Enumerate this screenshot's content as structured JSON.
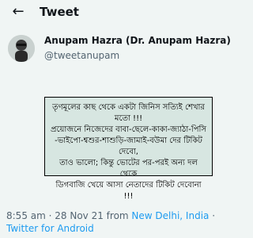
{
  "topbar": {
    "title": "Tweet",
    "back_icon": "back-arrow-icon"
  },
  "author": {
    "display_name": "Anupam Hazra (Dr. Anupam Hazra)",
    "handle": "@tweetanupam",
    "avatar_icon": "avatar"
  },
  "tweet": {
    "lines": [
      "তৃণমূলের কাছ থেকে একটা জিনিস সত্যিই শেখার",
      "মতো !!!",
      "প্রয়োজনে নিজেদের বাবা-ছেলে-কাকা-জ্যাঠা-পিসি",
      "-ভাইপো-শ্বশুর-শাশুড়ি-জামাই-বউমা দের টিকিট দেবো,",
      "তাও ভালো; কিন্তু ভোটের পর-পরই অন্য দল থেকে",
      "ডিগবাজি খেয়ে আসা নেতাদের টিকিট দেবোনা !!!"
    ]
  },
  "meta": {
    "time": "8:55 am",
    "sep": " · ",
    "date": "28 Nov 21 from ",
    "location": "New Delhi, India",
    "sep2": " · ",
    "client": "Twitter for Android"
  },
  "colors": {
    "link": "#1d9bf0",
    "card_bg": "#d7e6e1",
    "page_bg": "#f0f5f4"
  }
}
